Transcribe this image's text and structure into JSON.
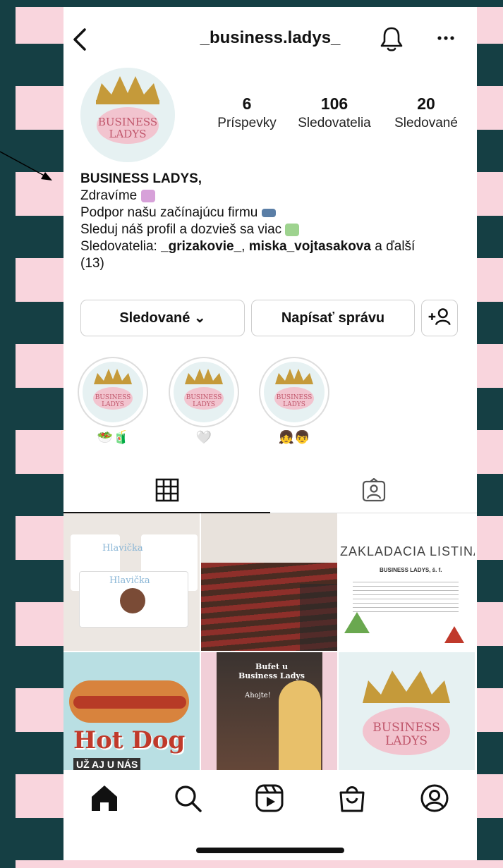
{
  "header": {
    "username": "_business.ladys_",
    "icons": [
      "back-icon",
      "bell-icon",
      "more-icon"
    ]
  },
  "profile": {
    "logo_line1": "BUSINESS",
    "logo_line2": "LADYS",
    "stats": [
      {
        "value": "6",
        "label": "Príspevky"
      },
      {
        "value": "106",
        "label": "Sledovatelia"
      },
      {
        "value": "20",
        "label": "Sledované"
      }
    ],
    "bio": {
      "name": "BUSINESS LADYS,",
      "line1": "Zdravíme",
      "line2": "Podpor našu začínajúcu firmu",
      "line3": "Sleduj náš profil a dozvieš sa viac",
      "line4_prefix": "Sledovatelia: ",
      "follower1": "_grizakovie_",
      "sep": ", ",
      "follower2": "miska_vojtasakova",
      "line4_suffix": " a ďalší",
      "line5": "(13)"
    }
  },
  "buttons": {
    "following": "Sledované ⌄",
    "message": "Napísať správu",
    "add_user": "+👤"
  },
  "highlights": [
    {
      "emoji": "🥗🧃"
    },
    {
      "emoji": "🤍"
    },
    {
      "emoji": "👧👦"
    }
  ],
  "posts": {
    "tile1": "Hlavička",
    "tile2": "",
    "tile3_title": "ZAKLADACIA LISTINA",
    "tile3_company": "BUSINESS LADYS, š. f.",
    "tile4_main": "Hot Dog",
    "tile4_sub": "UŽ AJ U NÁS",
    "tile5_title": "Bufet u Business Ladys",
    "tile5_greet": "Ahojte!",
    "tile6_line1": "BUSINESS",
    "tile6_line2": "LADYS"
  },
  "colors": {
    "accent_pink": "#f2c4cf",
    "logo_bg": "#e6f1f2",
    "crown_gold": "#c59a3a",
    "stripe_dark": "#153f44",
    "stripe_pink": "#f9d5dd"
  }
}
